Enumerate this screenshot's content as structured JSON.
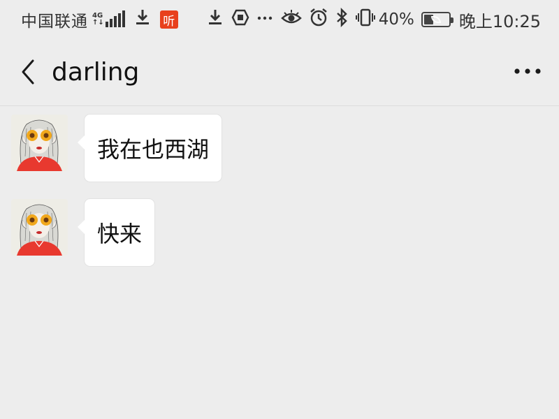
{
  "status_bar": {
    "carrier": "中国联通",
    "network_type": "4G",
    "network_sub": "↑↓",
    "app_badge": "听",
    "battery_percent": "40%",
    "battery_level": 0.4,
    "time": "晚上10:25",
    "icons": [
      "signal-icon",
      "download-icon",
      "ting-app-icon",
      "download-icon",
      "shield-icon",
      "more-dots-icon",
      "eye-icon",
      "alarm-icon",
      "bluetooth-icon",
      "vibrate-icon",
      "battery-icon"
    ]
  },
  "nav": {
    "title": "darling",
    "back_icon": "chevron-left-icon",
    "more_icon": "more-horizontal-icon"
  },
  "messages": [
    {
      "sender": "darling",
      "text": "我在也西湖"
    },
    {
      "sender": "darling",
      "text": "快来"
    }
  ],
  "colors": {
    "background": "#ededed",
    "bubble": "#ffffff",
    "badge_red": "#e8401c",
    "avatar_shirt": "#e8392f",
    "avatar_flower": "#f1a81c"
  }
}
